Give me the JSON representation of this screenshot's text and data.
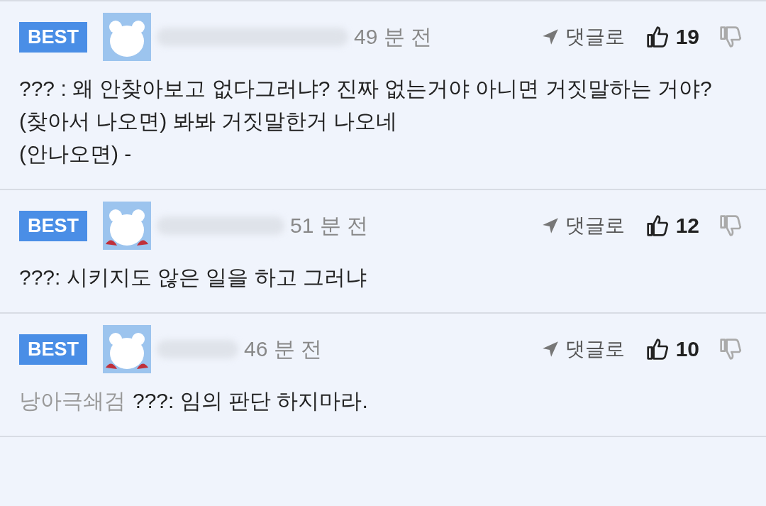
{
  "comments": [
    {
      "badge": "BEST",
      "time": "49 분 전",
      "reply": "댓글로",
      "likes": "19",
      "body": [
        "??? : 왜 안찾아보고 없다그러냐? 진짜 없는거야 아니면 거짓말하는 거야?",
        "(찾아서 나오면) 봐봐 거짓말한거 나오네",
        "(안나오면) -"
      ]
    },
    {
      "badge": "BEST",
      "time": "51 분 전",
      "reply": "댓글로",
      "likes": "12",
      "body": [
        "???: 시키지도 않은 일을 하고 그러냐"
      ]
    },
    {
      "badge": "BEST",
      "time": "46 분 전",
      "reply": "댓글로",
      "likes": "10",
      "mention": "낭아극쇄검",
      "body": [
        "???: 임의 판단 하지마라."
      ]
    }
  ]
}
